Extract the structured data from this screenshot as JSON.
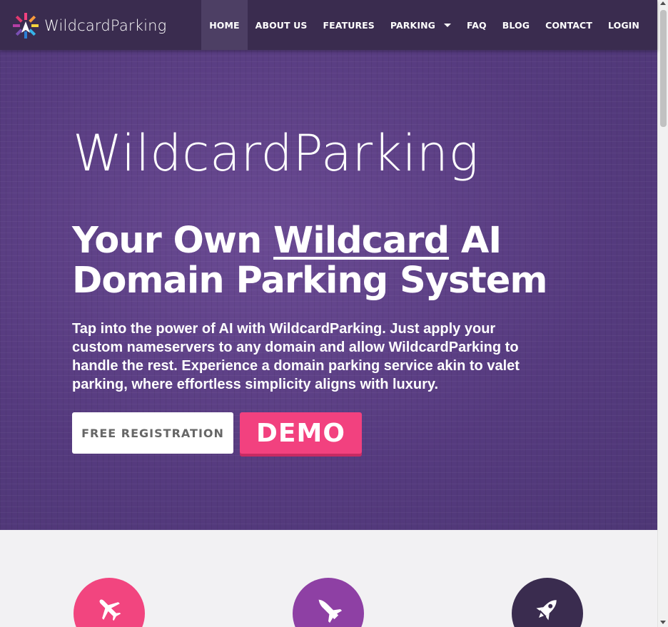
{
  "header": {
    "logo_text": "WildcardParking",
    "nav": [
      {
        "label": "HOME",
        "active": true
      },
      {
        "label": "ABOUT US"
      },
      {
        "label": "FEATURES"
      },
      {
        "label": "PARKING",
        "has_dropdown": true
      },
      {
        "label": "FAQ"
      },
      {
        "label": "BLOG"
      },
      {
        "label": "CONTACT"
      },
      {
        "label": "LOGIN"
      }
    ]
  },
  "hero": {
    "brand": "WildcardParking",
    "title_part1": "Your Own ",
    "title_emphasis": "Wildcard",
    "title_part2": " AI Domain Parking System",
    "description": "Tap into the power of AI with WildcardParking. Just apply your custom nameservers to any domain and allow WildcardParking to handle the rest. Experience a domain parking service akin to valet parking, where effortless simplicity aligns with luxury.",
    "primary_button": "FREE REGISTRATION",
    "demo_button": "DEMO"
  },
  "features": {
    "icons": [
      "airplane-icon",
      "space-shuttle-icon",
      "rocket-icon"
    ]
  },
  "colors": {
    "header_bg": "#3a2c4f",
    "hero_bg": "#5a3f84",
    "accent_pink": "#f2417f",
    "accent_purple": "#8e40a4",
    "dark_purple": "#3a2c4f"
  }
}
